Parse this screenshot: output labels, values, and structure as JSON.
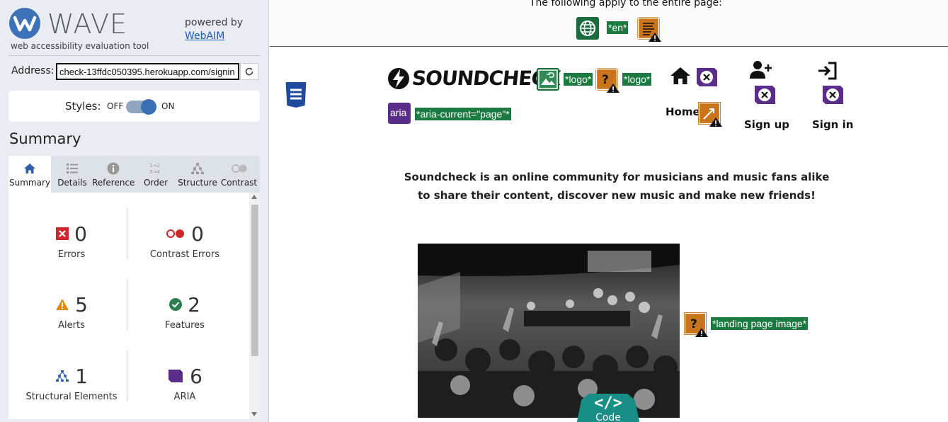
{
  "wave": {
    "logo_text": "WAVE",
    "tagline": "web accessibility evaluation tool",
    "powered_by": "powered by",
    "webaim_link": "WebAIM"
  },
  "address": {
    "label": "Address:",
    "value": "check-13ffdc050395.herokuapp.com/signin"
  },
  "styles": {
    "label": "Styles:",
    "off": "OFF",
    "on": "ON",
    "state": "on"
  },
  "summary_heading": "Summary",
  "tabs": [
    {
      "label": "Summary",
      "icon": "home-icon",
      "active": true
    },
    {
      "label": "Details",
      "icon": "list-icon"
    },
    {
      "label": "Reference",
      "icon": "info-icon"
    },
    {
      "label": "Order",
      "icon": "order-icon"
    },
    {
      "label": "Structure",
      "icon": "structure-icon"
    },
    {
      "label": "Contrast",
      "icon": "contrast-icon"
    }
  ],
  "stats": [
    {
      "label": "Errors",
      "count": "0",
      "icon": "error-icon",
      "color": "#d1262c"
    },
    {
      "label": "Contrast Errors",
      "count": "0",
      "icon": "contrast-error-icon",
      "color": "#d1262c"
    },
    {
      "label": "Alerts",
      "count": "5",
      "icon": "alert-icon",
      "color": "#e08a00"
    },
    {
      "label": "Features",
      "count": "2",
      "icon": "feature-icon",
      "color": "#2e7d4f"
    },
    {
      "label": "Structural Elements",
      "count": "1",
      "icon": "structure-icon",
      "color": "#2f5fa7"
    },
    {
      "label": "ARIA",
      "count": "6",
      "icon": "aria-icon",
      "color": "#5b2d8a"
    }
  ],
  "page": {
    "entire_page_text": "The following apply to the entire page:",
    "lang_label": "*en*",
    "logo_text": "SOUNDCHECK",
    "logo_alt_1": "*logo*",
    "logo_alt_2": "*logo*",
    "aria_icon_text": "aria",
    "aria_current": "*aria-current=\"page\"*",
    "nav_home": "Home",
    "nav_signup": "Sign up",
    "nav_signin": "Sign in",
    "intro": "Soundcheck is an online community for musicians and music fans alike to share their content, discover new music and make new friends!",
    "image_alt": "*landing page image*",
    "code_tab": "Code",
    "code_symbol": "</>"
  },
  "colors": {
    "wave_blue": "#3b72b8",
    "feature_green": "#1a7a3f",
    "alert_orange": "#c9741a",
    "aria_purple": "#5b2d8a",
    "code_teal": "#178e86"
  }
}
